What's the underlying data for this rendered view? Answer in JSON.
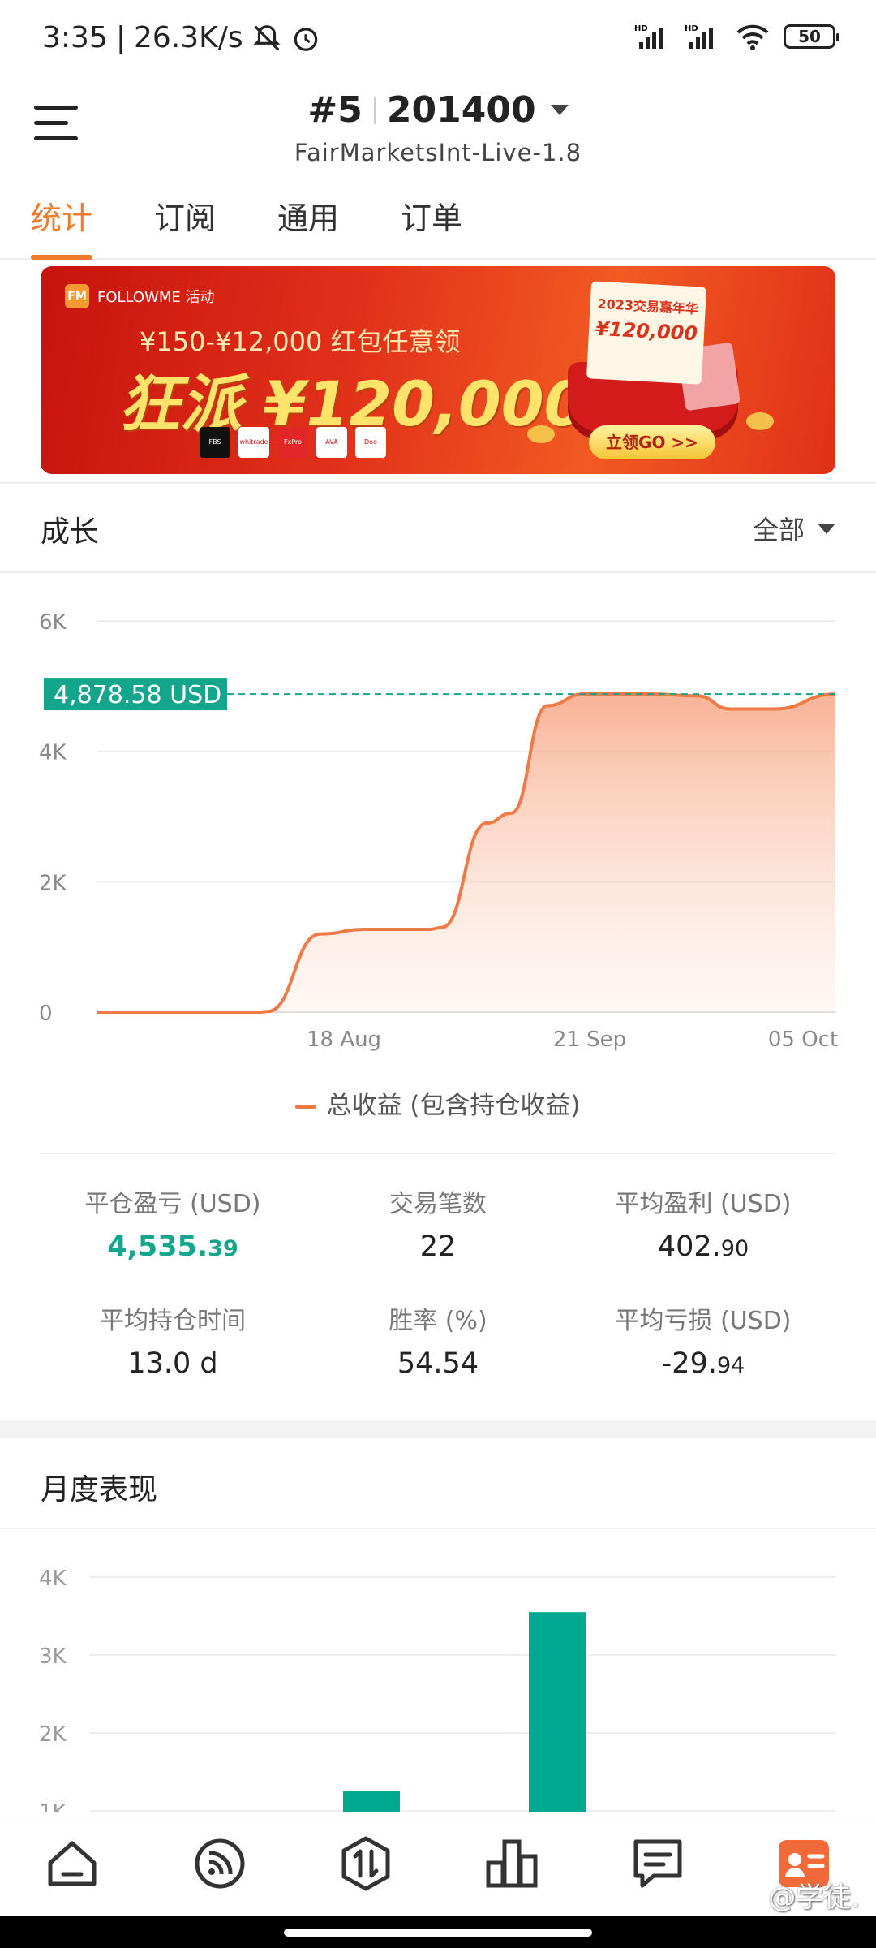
{
  "status_bar": {
    "time": "3:35",
    "network_speed": "26.3K/s",
    "battery": "50",
    "icons": [
      "bell-off-icon",
      "alarm-icon",
      "signal-hd-icon",
      "signal-hd-icon",
      "wifi-icon",
      "battery-icon"
    ]
  },
  "header": {
    "rank": "#5",
    "account_number": "201400",
    "server": "FairMarketsInt-Live-1.8"
  },
  "tabs": [
    {
      "label": "统计",
      "active": true
    },
    {
      "label": "订阅",
      "active": false
    },
    {
      "label": "通用",
      "active": false
    },
    {
      "label": "订单",
      "active": false
    }
  ],
  "banner": {
    "brand": "FOLLOWME 活动",
    "logo_text": "FM",
    "subtitle": "¥150-¥12,000 红包任意领",
    "headline": "狂派 ¥120,000",
    "card_title": "2023交易嘉年华",
    "card_amount": "¥120,000",
    "cta": "立领GO >>",
    "brokers": [
      "FBS",
      "whitrade",
      "FxPro",
      "AVA",
      "Doo Prime"
    ]
  },
  "growth": {
    "title": "成长",
    "filter": "全部",
    "current_value_label": "4,878.58 USD",
    "legend": "总收益 (包含持仓收益)"
  },
  "chart_data": [
    {
      "type": "area",
      "title": "成长",
      "x_ticks": [
        "18 Aug",
        "21 Sep",
        "05 Oct"
      ],
      "y_ticks": [
        "0",
        "2K",
        "4K",
        "6K"
      ],
      "ylim": [
        0,
        6000
      ],
      "series": [
        {
          "name": "总收益 (包含持仓收益)",
          "values": [
            0,
            0,
            0,
            0,
            10,
            1200,
            1270,
            1270,
            1300,
            2900,
            3050,
            4700,
            4880,
            4880,
            4850,
            4650,
            4650,
            4878.58
          ]
        }
      ],
      "reference_value": 4878.58,
      "colors": {
        "line": "#f07a45",
        "reference": "#14a68d"
      }
    },
    {
      "type": "bar",
      "title": "月度表现",
      "y_ticks": [
        "1K",
        "2K",
        "3K",
        "4K"
      ],
      "ylim": [
        0,
        4000
      ],
      "series": [
        {
          "values": [
            1250,
            3550
          ]
        }
      ],
      "colors": {
        "bar": "#00a98f"
      }
    }
  ],
  "stats": [
    {
      "label": "平仓盈亏 (USD)",
      "int": "4,535.",
      "dec": "39",
      "style": "green"
    },
    {
      "label": "交易笔数",
      "int": "22",
      "dec": "",
      "style": "normal"
    },
    {
      "label": "平均盈利 (USD)",
      "int": "402.",
      "dec": "90",
      "style": "normal"
    },
    {
      "label": "平均持仓时间",
      "int": "13.0 d",
      "dec": "",
      "style": "normal"
    },
    {
      "label": "胜率 (%)",
      "int": "54.54",
      "dec": "",
      "style": "normal"
    },
    {
      "label": "平均亏损 (USD)",
      "int": "-29.",
      "dec": "94",
      "style": "normal"
    }
  ],
  "monthly": {
    "title": "月度表现"
  },
  "bottom_nav": [
    "home-icon",
    "subscribe-icon",
    "trade-icon",
    "ranking-icon",
    "message-icon",
    "profile-icon"
  ],
  "watermark": "@学徒.",
  "colors": {
    "accent": "#f07a2a",
    "green": "#14a68d",
    "bar": "#00a98f"
  }
}
